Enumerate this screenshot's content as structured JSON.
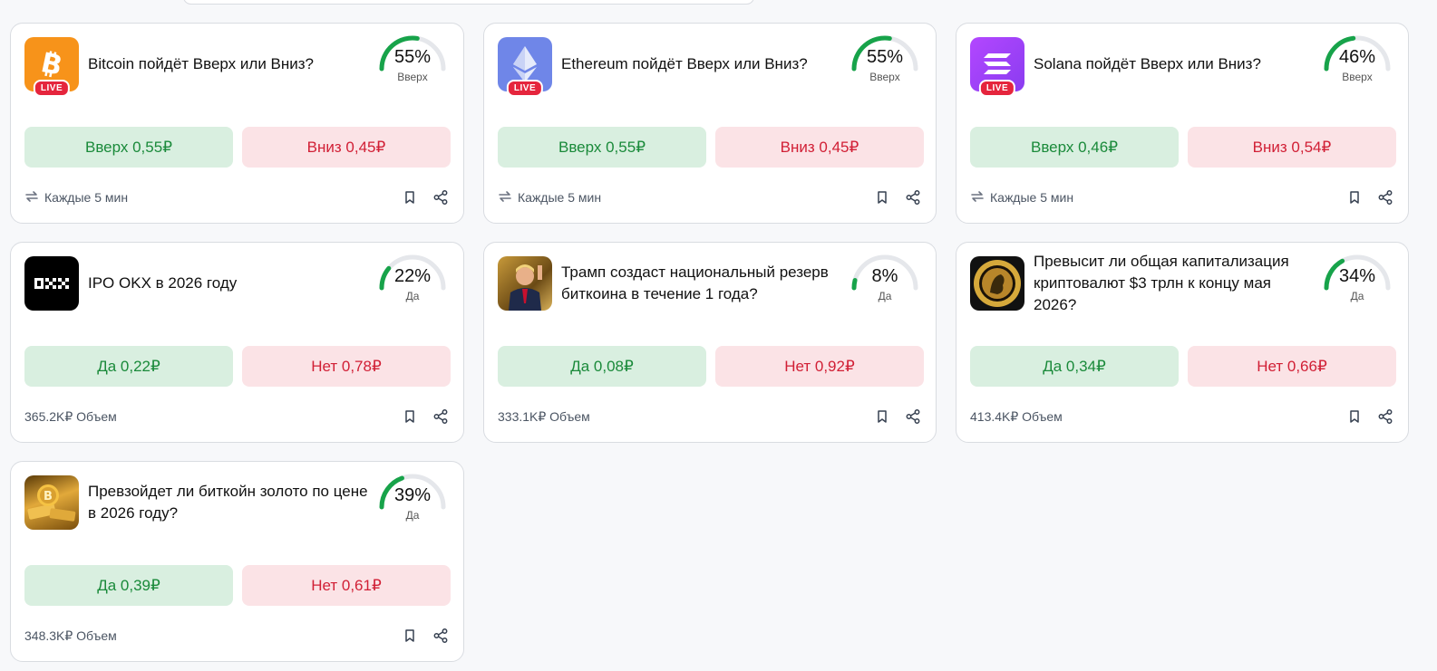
{
  "colors": {
    "yes_bg": "#d9efe0",
    "yes_text": "#1a8a3a",
    "no_bg": "#fbe3e6",
    "no_text": "#d11f35",
    "gauge_fill": "#17a34a",
    "gauge_track": "#e5e7eb",
    "live": "#e5253d"
  },
  "cards": [
    {
      "id": "btc",
      "icon": "bitcoin-icon",
      "live": true,
      "live_label": "LIVE",
      "title": "Bitcoin пойдёт Вверх или Вниз?",
      "percent": 55,
      "percent_label": "55%",
      "gauge_label": "Вверх",
      "yes_label": "Вверх 0,55₽",
      "no_label": "Вниз 0,45₽",
      "footer_type": "recurring",
      "footer_text": "Каждые 5 мин"
    },
    {
      "id": "eth",
      "icon": "ethereum-icon",
      "live": true,
      "live_label": "LIVE",
      "title": "Ethereum пойдёт Вверх или Вниз?",
      "percent": 55,
      "percent_label": "55%",
      "gauge_label": "Вверх",
      "yes_label": "Вверх 0,55₽",
      "no_label": "Вниз 0,45₽",
      "footer_type": "recurring",
      "footer_text": "Каждые 5 мин"
    },
    {
      "id": "sol",
      "icon": "solana-icon",
      "live": true,
      "live_label": "LIVE",
      "title": "Solana пойдёт Вверх или Вниз?",
      "percent": 46,
      "percent_label": "46%",
      "gauge_label": "Вверх",
      "yes_label": "Вверх 0,46₽",
      "no_label": "Вниз 0,54₽",
      "footer_type": "recurring",
      "footer_text": "Каждые 5 мин"
    },
    {
      "id": "okx",
      "icon": "okx-logo-icon",
      "live": false,
      "title": "IPO OKX в 2026 году",
      "percent": 22,
      "percent_label": "22%",
      "gauge_label": "Да",
      "yes_label": "Да 0,22₽",
      "no_label": "Нет 0,78₽",
      "footer_type": "volume",
      "footer_text": "365.2K₽ Объем"
    },
    {
      "id": "trump",
      "icon": "trump-photo-icon",
      "live": false,
      "title": "Трамп создаст национальный резерв биткоина в течение 1 года?",
      "percent": 8,
      "percent_label": "8%",
      "gauge_label": "Да",
      "yes_label": "Да 0,08₽",
      "no_label": "Нет 0,92₽",
      "footer_type": "volume",
      "footer_text": "333.1K₽ Объем"
    },
    {
      "id": "cap",
      "icon": "gold-coin-icon",
      "live": false,
      "title": "Превысит ли общая капитализация криптовалют $3 трлн к концу мая 2026?",
      "percent": 34,
      "percent_label": "34%",
      "gauge_label": "Да",
      "yes_label": "Да 0,34₽",
      "no_label": "Нет 0,66₽",
      "footer_type": "volume",
      "footer_text": "413.4K₽ Объем"
    },
    {
      "id": "gold",
      "icon": "gold-bitcoin-photo-icon",
      "live": false,
      "title": "Превзойдет ли биткойн золото по цене в 2026 году?",
      "percent": 39,
      "percent_label": "39%",
      "gauge_label": "Да",
      "yes_label": "Да 0,39₽",
      "no_label": "Нет 0,61₽",
      "footer_type": "volume",
      "footer_text": "348.3K₽ Объем"
    }
  ]
}
